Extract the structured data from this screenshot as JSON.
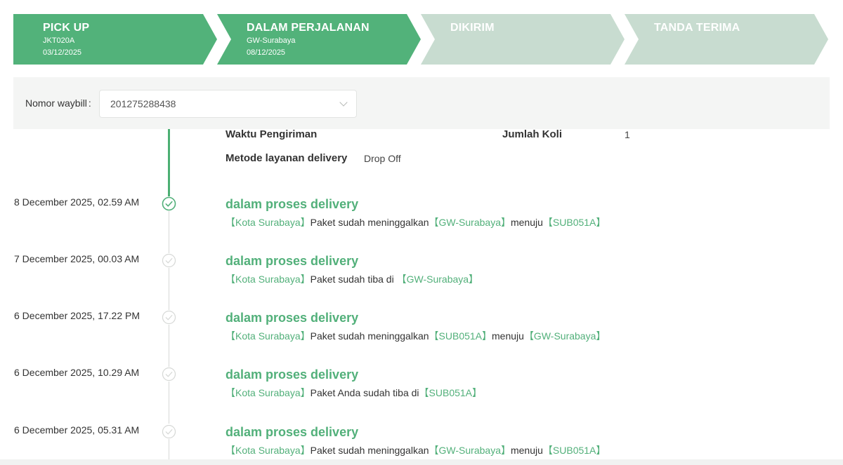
{
  "colors": {
    "step_active": "#52b27a",
    "step_inactive": "#c8dcd0",
    "accent_text": "#52b07a",
    "timeline_active_line": "#4caf73",
    "timeline_inactive": "#d6d8d6"
  },
  "stepper": {
    "steps": [
      {
        "title": "PICK UP",
        "line1": "JKT020A",
        "line2": "03/12/2025",
        "state": "done"
      },
      {
        "title": "DALAM PERJALANAN",
        "line1": "GW-Surabaya",
        "line2": "08/12/2025",
        "state": "current"
      },
      {
        "title": "DIKIRIM",
        "line1": "",
        "line2": "",
        "state": "pending"
      },
      {
        "title": "TANDA TERIMA",
        "line1": "",
        "line2": "",
        "state": "pending"
      }
    ]
  },
  "waybill": {
    "label": "Nomor waybill",
    "colon": ":",
    "value": "201275288438",
    "icon": "chevron-down-icon"
  },
  "info": {
    "shipping_time_label": "Waktu Pengiriman",
    "shipping_time_value": "",
    "koli_label": "Jumlah Koli",
    "koli_value": "1",
    "method_label": "Metode layanan delivery",
    "method_value": "Drop Off"
  },
  "timeline": {
    "events": [
      {
        "time": "8 December 2025, 02.59 AM",
        "title": "dalam proses delivery",
        "desc": [
          {
            "text": "【Kota Surabaya】",
            "hl": true
          },
          {
            "text": "Paket sudah meninggalkan",
            "hl": false
          },
          {
            "text": "【GW-Surabaya】",
            "hl": true
          },
          {
            "text": "menuju",
            "hl": false
          },
          {
            "text": "【SUB051A】",
            "hl": true
          }
        ],
        "active": true
      },
      {
        "time": "7 December 2025, 00.03 AM",
        "title": "dalam proses delivery",
        "desc": [
          {
            "text": "【Kota Surabaya】",
            "hl": true
          },
          {
            "text": "Paket sudah tiba di ",
            "hl": false
          },
          {
            "text": "【GW-Surabaya】",
            "hl": true
          }
        ],
        "active": false
      },
      {
        "time": "6 December 2025, 17.22 PM",
        "title": "dalam proses delivery",
        "desc": [
          {
            "text": "【Kota Surabaya】",
            "hl": true
          },
          {
            "text": "Paket sudah meninggalkan",
            "hl": false
          },
          {
            "text": "【SUB051A】",
            "hl": true
          },
          {
            "text": "menuju",
            "hl": false
          },
          {
            "text": "【GW-Surabaya】",
            "hl": true
          }
        ],
        "active": false
      },
      {
        "time": "6 December 2025, 10.29 AM",
        "title": "dalam proses delivery",
        "desc": [
          {
            "text": "【Kota Surabaya】",
            "hl": true
          },
          {
            "text": "Paket Anda sudah tiba di",
            "hl": false
          },
          {
            "text": "【SUB051A】",
            "hl": true
          }
        ],
        "active": false
      },
      {
        "time": "6 December 2025, 05.31 AM",
        "title": "dalam proses delivery",
        "desc": [
          {
            "text": "【Kota Surabaya】",
            "hl": true
          },
          {
            "text": "Paket sudah meninggalkan",
            "hl": false
          },
          {
            "text": "【GW-Surabaya】",
            "hl": true
          },
          {
            "text": "menuju",
            "hl": false
          },
          {
            "text": "【SUB051A】",
            "hl": true
          }
        ],
        "active": false
      }
    ]
  }
}
